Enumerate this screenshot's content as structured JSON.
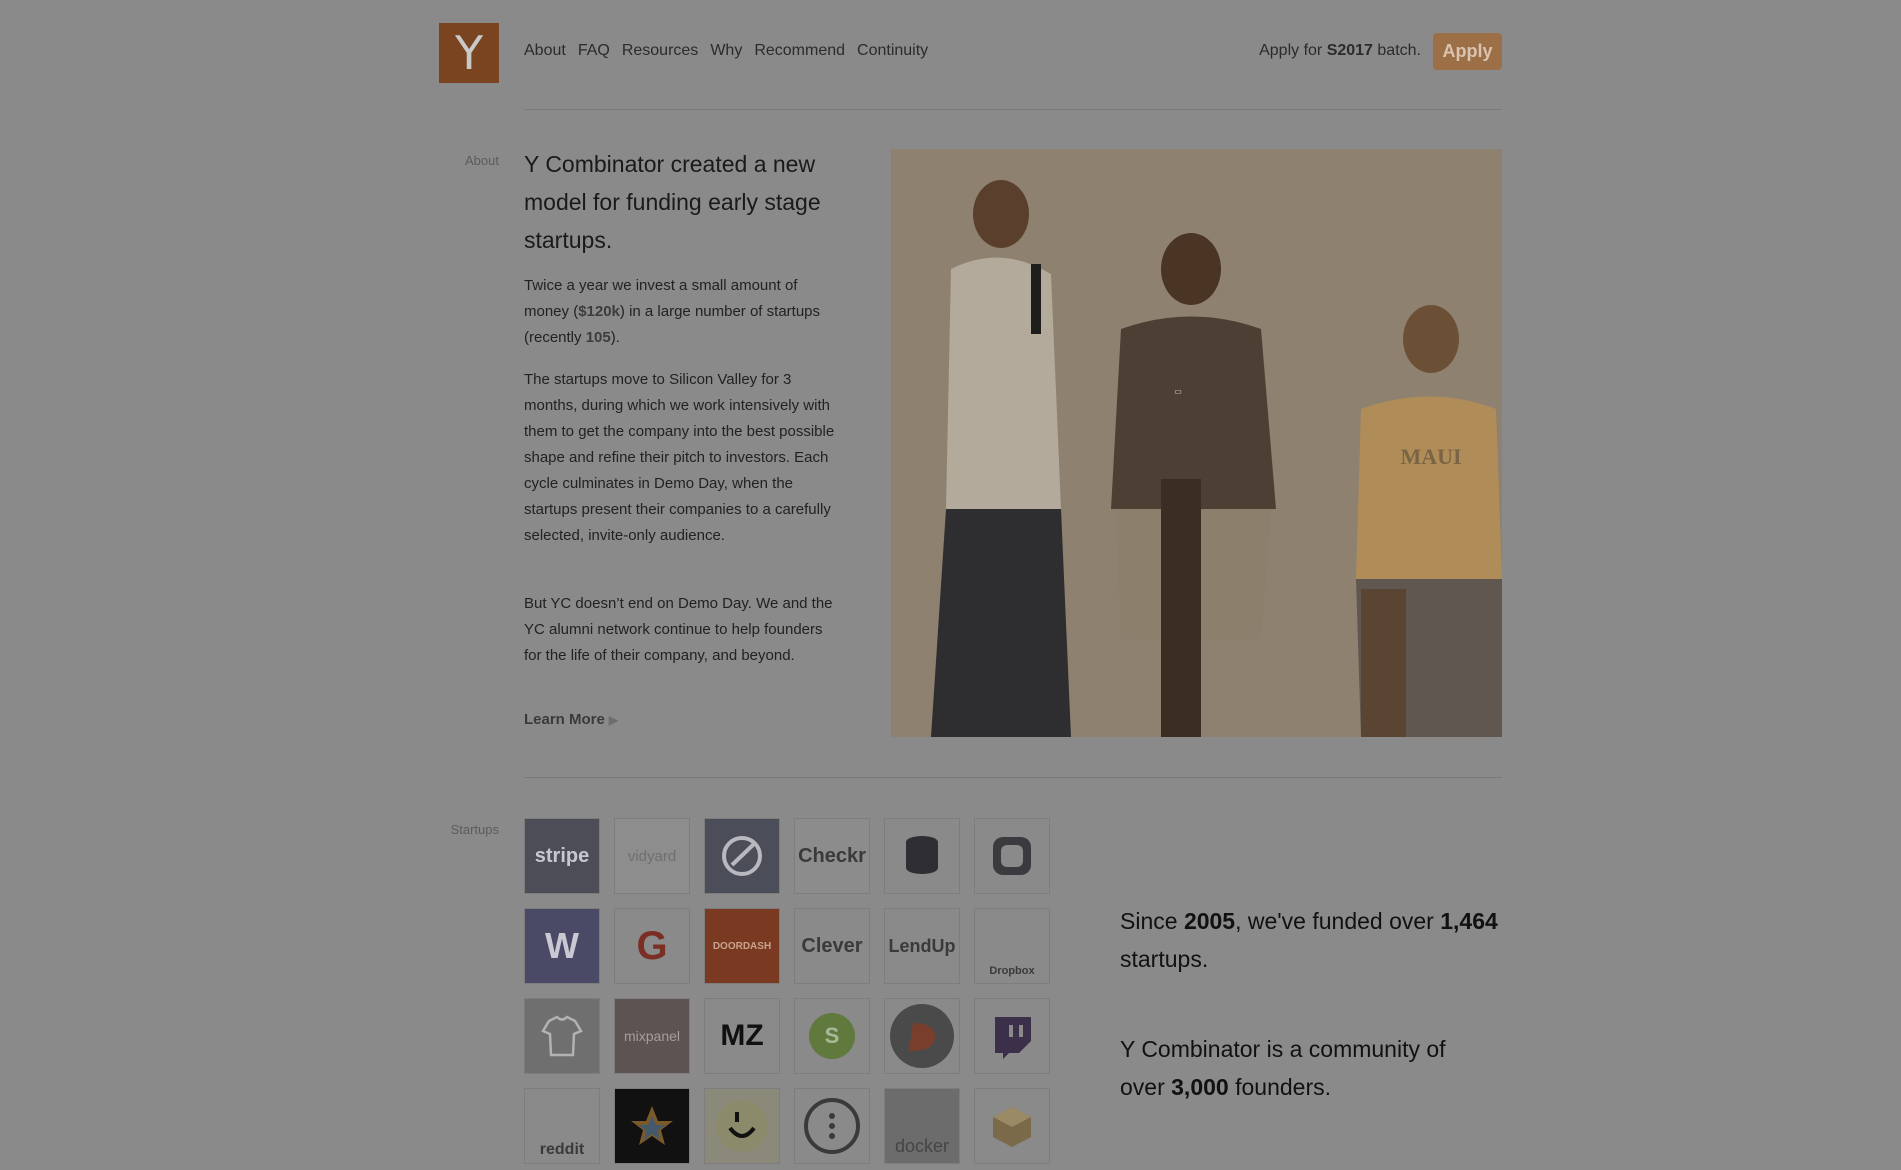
{
  "header": {
    "logo_letter": "Y",
    "nav": [
      "About",
      "FAQ",
      "Resources",
      "Why",
      "Recommend",
      "Continuity"
    ],
    "apply_prefix": "Apply for",
    "apply_batch": "S2017",
    "apply_suffix": "batch.",
    "apply_button": "Apply"
  },
  "about": {
    "section_label": "About",
    "headline": "Y Combinator created a new model for funding early stage startups.",
    "p1_a": "Twice a year we invest a small amount of money (",
    "p1_amount": "$120k",
    "p1_b": ") in a large number of startups (recently ",
    "p1_count": "105",
    "p1_c": ").",
    "p2": "The startups move to Silicon Valley for 3 months, during which we work intensively with them to get the company into the best possible shape and refine their pitch to investors. Each cycle culminates in Demo Day, when the startups present their companies to a carefully selected, invite-only audience.",
    "p3": "But YC doesn’t end on Demo Day. We and the YC alumni network continue to help founders for the life of their company, and beyond.",
    "learn_more": "Learn More",
    "photo_shirt_text": "MAUI"
  },
  "startups": {
    "section_label": "Startups",
    "logos": [
      {
        "name": "stripe",
        "text": "stripe"
      },
      {
        "name": "vidyard",
        "text": "vidyard"
      },
      {
        "name": "optimizely",
        "text": ""
      },
      {
        "name": "checkr",
        "text": "Checkr"
      },
      {
        "name": "coins",
        "text": ""
      },
      {
        "name": "q-logo",
        "text": ""
      },
      {
        "name": "weebly",
        "text": "W"
      },
      {
        "name": "g-logo",
        "text": "G"
      },
      {
        "name": "doordash",
        "text": "DOORDASH"
      },
      {
        "name": "clever",
        "text": "Clever"
      },
      {
        "name": "lendup",
        "text": "LendUp"
      },
      {
        "name": "dropbox",
        "text": "Dropbox"
      },
      {
        "name": "shirt",
        "text": ""
      },
      {
        "name": "mixpanel",
        "text": "mixpanel"
      },
      {
        "name": "machinezone",
        "text": "MZ"
      },
      {
        "name": "s-logo",
        "text": "S"
      },
      {
        "name": "d-logo",
        "text": ""
      },
      {
        "name": "twitch",
        "text": ""
      },
      {
        "name": "reddit",
        "text": "reddit"
      },
      {
        "name": "instacart",
        "text": ""
      },
      {
        "name": "smile",
        "text": ""
      },
      {
        "name": "dots",
        "text": ""
      },
      {
        "name": "docker",
        "text": "docker"
      },
      {
        "name": "box",
        "text": ""
      }
    ],
    "stat1_a": "Since",
    "stat1_year": "2005",
    "stat1_b": ", we've funded over",
    "stat1_count": "1,464",
    "stat1_c": "startups.",
    "stat2_a": "Y Combinator is a community of over",
    "stat2_count": "3,000",
    "stat2_b": "founders."
  },
  "colors": {
    "overlay_bg": "#8a8a8a",
    "logo_bg": "#7a4420",
    "apply_bg": "#9c6f47"
  }
}
